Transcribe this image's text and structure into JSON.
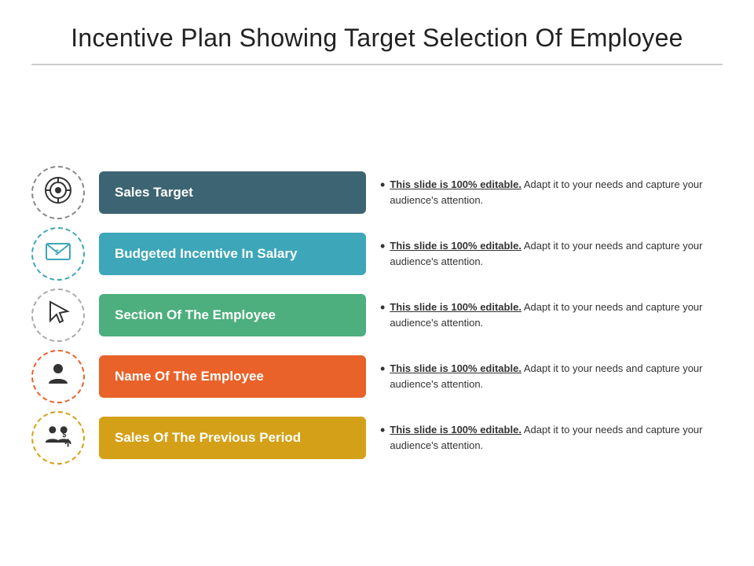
{
  "slide": {
    "title": "Incentive Plan Showing Target Selection Of Employee",
    "rows": [
      {
        "id": "sales-target",
        "label": "Sales Target",
        "colorClass": "color-1",
        "iconName": "target-icon",
        "iconColor": "#333",
        "description": {
          "bold": "This slide is 100% editable.",
          "normal": " Adapt it to your needs and capture your audience's attention."
        }
      },
      {
        "id": "budgeted-incentive",
        "label": "Budgeted Incentive In Salary",
        "colorClass": "color-2",
        "iconName": "envelope-dollar-icon",
        "iconColor": "#3da6b8",
        "description": {
          "bold": "This slide is 100% editable.",
          "normal": " Adapt it to your needs and capture your audience's attention."
        }
      },
      {
        "id": "section-employee",
        "label": "Section Of The Employee",
        "colorClass": "color-3",
        "iconName": "cursor-icon",
        "iconColor": "#333",
        "description": {
          "bold": "This slide is 100% editable.",
          "normal": " Adapt it to your needs and capture your audience's attention."
        }
      },
      {
        "id": "name-employee",
        "label": "Name Of The Employee",
        "colorClass": "color-4",
        "iconName": "person-icon",
        "iconColor": "#e8622a",
        "description": {
          "bold": "This slide is 100% editable.",
          "normal": " Adapt it to your needs and capture your audience's attention."
        }
      },
      {
        "id": "sales-previous",
        "label": "Sales Of The Previous Period",
        "colorClass": "color-5",
        "iconName": "group-dollar-icon",
        "iconColor": "#d4a017",
        "description": {
          "bold": "This slide is 100% editable.",
          "normal": " Adapt it to your needs and capture your audience's attention."
        }
      }
    ]
  }
}
